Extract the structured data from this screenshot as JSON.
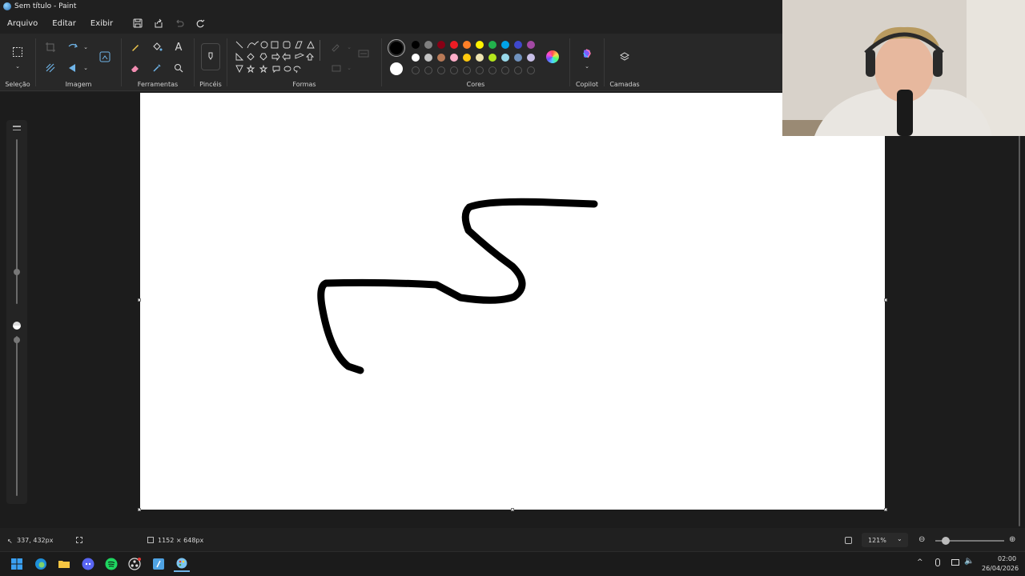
{
  "window": {
    "title": "Sem título - Paint"
  },
  "menu": {
    "items": [
      "Arquivo",
      "Editar",
      "Exibir"
    ]
  },
  "ribbon": {
    "groups": {
      "selection": "Seleção",
      "image": "Imagem",
      "tools": "Ferramentas",
      "brushes": "Pincéis",
      "shapes": "Formas",
      "colors": "Cores",
      "copilot": "Copilot",
      "layers": "Camadas"
    },
    "palette_row1": [
      "#000000",
      "#7f7f7f",
      "#880015",
      "#ed1c24",
      "#ff7f27",
      "#fff200",
      "#22b14c",
      "#00a2e8",
      "#3f48cc",
      "#a349a4"
    ],
    "palette_row2": [
      "#ffffff",
      "#c3c3c3",
      "#b97a57",
      "#ffaec9",
      "#ffc90e",
      "#efe4b0",
      "#b5e61d",
      "#99d9ea",
      "#7092be",
      "#c8bfe7"
    ],
    "primary_color": "#000000",
    "secondary_color": "#ffffff"
  },
  "canvas": {
    "background": "#ffffff",
    "stroke_color": "#000000"
  },
  "status": {
    "cursor_pos": "337, 432px",
    "canvas_size": "1152 × 648px",
    "zoom": "121%"
  },
  "taskbar": {
    "time": "02:00",
    "date": "26/04/2026"
  }
}
